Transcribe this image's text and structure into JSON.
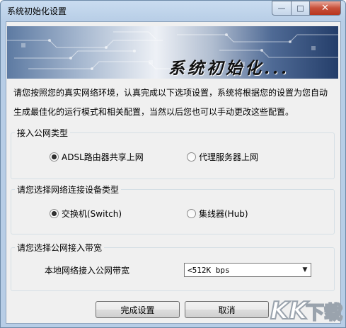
{
  "window": {
    "title": "系统初始化设置",
    "minimize_glyph": "—",
    "maximize_glyph": "□",
    "close_glyph": "✕"
  },
  "banner": {
    "title": "系统初始化..."
  },
  "intro": {
    "text": "请您按照您的真实网络环境，认真完成以下选项设置，系统将根据您的设置为您自动生成最佳化的运行模式和相关配置，当然以后您也可以手动更改这些配置。"
  },
  "groups": {
    "access_type": {
      "legend": "接入公网类型",
      "options": [
        {
          "label": "ADSL路由器共享上网",
          "selected": true
        },
        {
          "label": "代理服务器上网",
          "selected": false
        }
      ]
    },
    "device_type": {
      "legend": "请您选择网络连接设备类型",
      "options": [
        {
          "label": "交换机(Switch)",
          "selected": true
        },
        {
          "label": "集线器(Hub)",
          "selected": false
        }
      ]
    },
    "bandwidth": {
      "legend": "请您选择公网接入带宽",
      "field_label": "本地网络接入公网带宽",
      "selected_value": "<512K bps"
    }
  },
  "buttons": {
    "finish": "完成设置",
    "cancel": "取消"
  },
  "watermark": {
    "text": "KK下载"
  }
}
